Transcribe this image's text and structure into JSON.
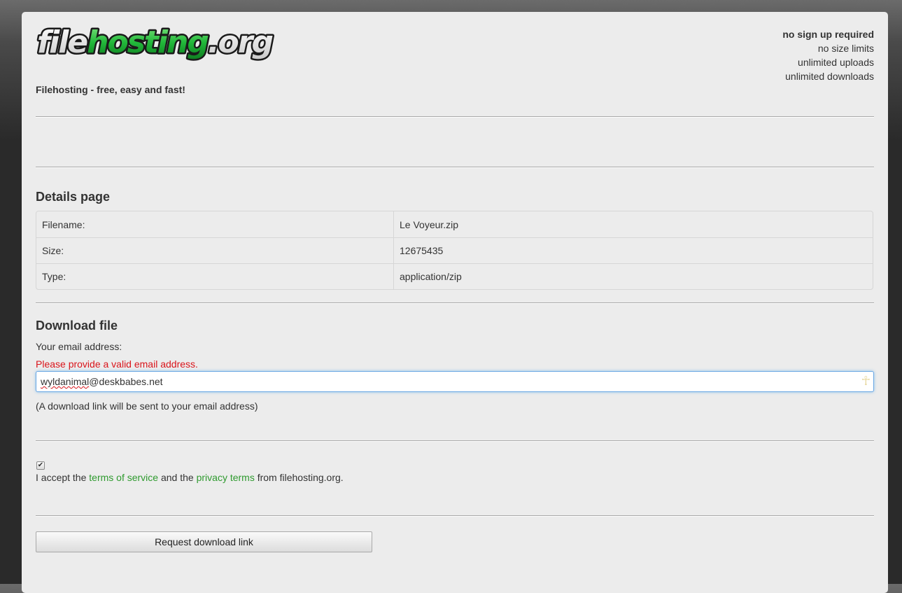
{
  "header": {
    "logo": {
      "part1": "file",
      "part2": "hosting",
      "part3": ".org"
    },
    "tagline": "Filehosting - free, easy and fast!",
    "features": [
      "no sign up required",
      "no size limits",
      "unlimited uploads",
      "unlimited downloads"
    ]
  },
  "details": {
    "heading": "Details page",
    "rows": [
      {
        "key": "Filename:",
        "value": "Le Voyeur.zip"
      },
      {
        "key": "Size:",
        "value": "12675435"
      },
      {
        "key": "Type:",
        "value": "application/zip"
      }
    ]
  },
  "download": {
    "heading": "Download file",
    "email_label": "Your email address:",
    "error": "Please provide a valid email address.",
    "email_value_part1": "wyldanimal",
    "email_value_part2": "@deskbabes.net",
    "hint": "(A download link will be sent to your email address)"
  },
  "terms": {
    "checked": true,
    "prefix": "I accept the ",
    "tos_link": "terms of service",
    "middle": " and the ",
    "privacy_link": "privacy terms",
    "suffix": " from filehosting.org."
  },
  "submit": {
    "label": "Request download link"
  },
  "colors": {
    "accent_green": "#2e9a2e",
    "error_red": "#d9141b",
    "logo_green": "#22b83a"
  }
}
